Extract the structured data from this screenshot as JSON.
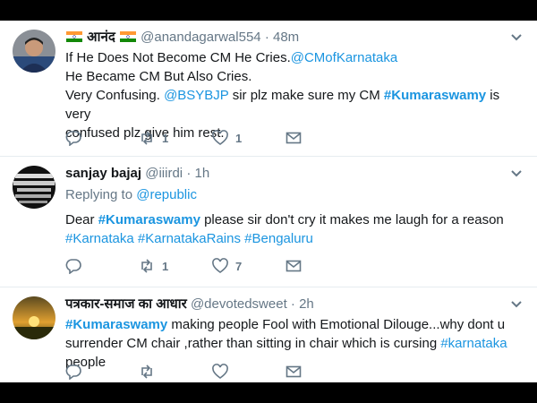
{
  "tweets": [
    {
      "name_prefix_flag": "india-flag",
      "name": "आनंद",
      "handle": "@anandagarwal554",
      "separator": "·",
      "time": "48m",
      "line1_text": "If He Does Not Become CM He Cries.",
      "line1_mention": "@CMofKarnataka",
      "line2_text": "He Became CM But Also Cries.",
      "line3_text_a": "Very Confusing. ",
      "line3_mention": "@BSYBJP",
      "line3_text_b": " sir plz make sure my CM ",
      "line3_hashtag": "#Kumaraswamy",
      "line3_text_c": " is very",
      "line4_text": "confused plz give him rest.",
      "retweets": "1",
      "likes": "1"
    },
    {
      "name": "sanjay bajaj",
      "handle": "@iiirdi",
      "separator": "·",
      "time": "1h",
      "replying_prefix": "Replying to ",
      "replying_handle": "@republic",
      "line1_text_a": "Dear ",
      "line1_hashtag": "#Kumaraswamy",
      "line1_text_b": " please sir don't cry it makes me laugh for a reason",
      "line2_hashtags": [
        "#Karnataka",
        "#KarnatakaRains",
        "#Bengaluru"
      ],
      "retweets": "1",
      "likes": "7"
    },
    {
      "name": "पत्रकार-समाज का आधार",
      "handle": "@devotedsweet",
      "separator": "·",
      "time": "2h",
      "line1_hashtag": "#Kumaraswamy",
      "line1_text": " making people Fool with Emotional Dilouge...why dont u",
      "line2_text_a": "surrender CM chair ,rather than sitting in chair which is cursing ",
      "line2_hashtag": "#karnataka",
      "line2_text_b": " people",
      "retweets": "",
      "likes": ""
    }
  ],
  "icons": {
    "reply": "reply-icon",
    "retweet": "retweet-icon",
    "like": "heart-icon",
    "message": "envelope-icon",
    "more": "chevron-down-icon"
  },
  "colors": {
    "link": "#1b95e0",
    "muted": "#657786",
    "text": "#14171a"
  }
}
